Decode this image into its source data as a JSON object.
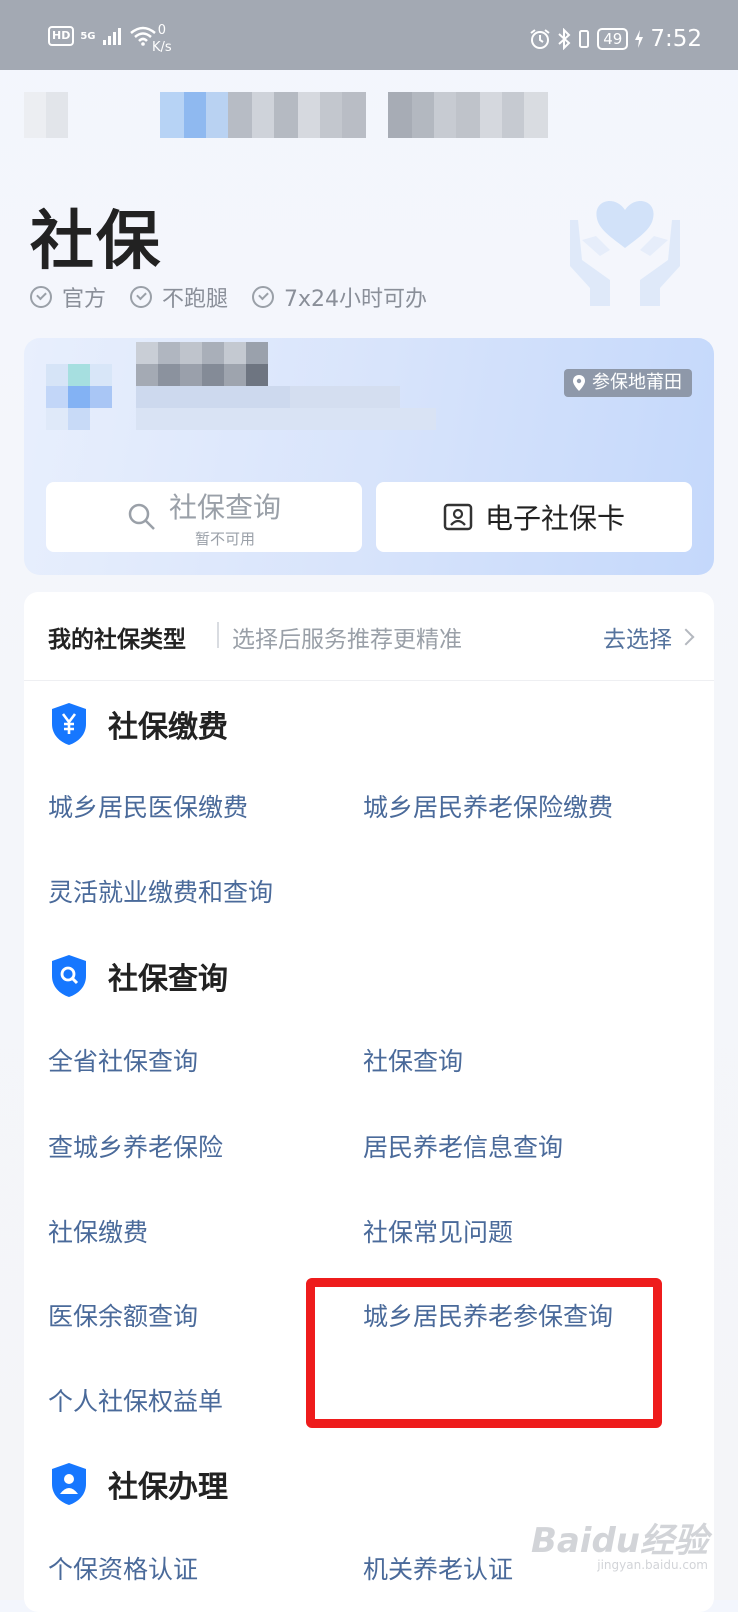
{
  "status_bar": {
    "hd": "HD",
    "network": "5G",
    "speed_value": "0",
    "speed_unit": "K/s",
    "battery": "49",
    "time": "7:52"
  },
  "header": {
    "title": "社保",
    "tags": [
      "官方",
      "不跑腿",
      "7x24小时可办"
    ]
  },
  "card": {
    "location": "参保地莆田",
    "query_button": {
      "label": "社保查询",
      "sublabel": "暂不可用"
    },
    "ecard_button": {
      "label": "电子社保卡"
    }
  },
  "insurance_type": {
    "title": "我的社保类型",
    "hint": "选择后服务推荐更精准",
    "action": "去选择"
  },
  "sections": [
    {
      "title": "社保缴费",
      "icon": "yen-shield-icon",
      "items": [
        "城乡居民医保缴费",
        "城乡居民养老保险缴费",
        "灵活就业缴费和查询"
      ]
    },
    {
      "title": "社保查询",
      "icon": "search-shield-icon",
      "items": [
        "全省社保查询",
        "社保查询",
        "查城乡养老保险",
        "居民养老信息查询",
        "社保缴费",
        "社保常见问题",
        "医保余额查询",
        "城乡居民养老参保查询",
        "个人社保权益单"
      ]
    },
    {
      "title": "社保办理",
      "icon": "person-shield-icon",
      "items": [
        "个保资格认证",
        "机关养老认证"
      ]
    }
  ],
  "watermark": {
    "text": "Baidu经验",
    "sub": "jingyan.baidu.com"
  },
  "colors": {
    "accent": "#1677ff",
    "link": "#4a6a9a",
    "highlight": "#ee1c1c"
  }
}
